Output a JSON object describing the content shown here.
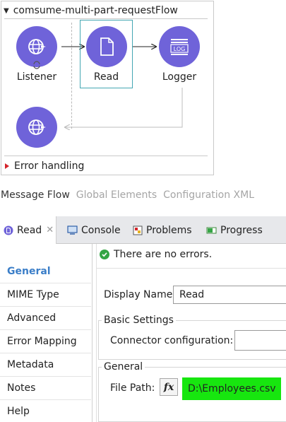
{
  "flow": {
    "title": "comsume-multi-part-requestFlow",
    "nodes": [
      {
        "label": "Listener",
        "icon": "globe-icon"
      },
      {
        "label": "Read",
        "icon": "document-icon"
      },
      {
        "label": "Logger",
        "icon": "log-icon"
      }
    ],
    "log_badge": "LOG",
    "error_handling_label": "Error handling"
  },
  "editor_tabs": [
    {
      "label": "Message Flow"
    },
    {
      "label": "Global Elements"
    },
    {
      "label": "Configuration XML"
    }
  ],
  "view_tabs": [
    {
      "label": "Read",
      "icon": "read-badge-icon"
    },
    {
      "label": "Console",
      "icon": "monitor-icon"
    },
    {
      "label": "Problems",
      "icon": "problems-icon"
    },
    {
      "label": "Progress",
      "icon": "progress-icon"
    }
  ],
  "sidebar": {
    "items": [
      {
        "label": "General"
      },
      {
        "label": "MIME Type"
      },
      {
        "label": "Advanced"
      },
      {
        "label": "Error Mapping"
      },
      {
        "label": "Metadata"
      },
      {
        "label": "Notes"
      },
      {
        "label": "Help"
      }
    ]
  },
  "status": {
    "message": "There are no errors."
  },
  "form": {
    "display_name_label": "Display Name:",
    "display_name_value": "Read",
    "basic_settings_title": "Basic Settings",
    "connector_label": "Connector configuration:",
    "general_title": "General",
    "file_path_label": "File Path:",
    "fx_label": "fx",
    "file_path_value": "D:\\Employees.csv"
  },
  "colors": {
    "node_purple": "#6f63d9",
    "selection": "#44a7b3",
    "sidebar_active": "#3b7ec8",
    "highlight": "#17e60f",
    "error_triangle": "#d4232a",
    "success": "#35a545"
  }
}
